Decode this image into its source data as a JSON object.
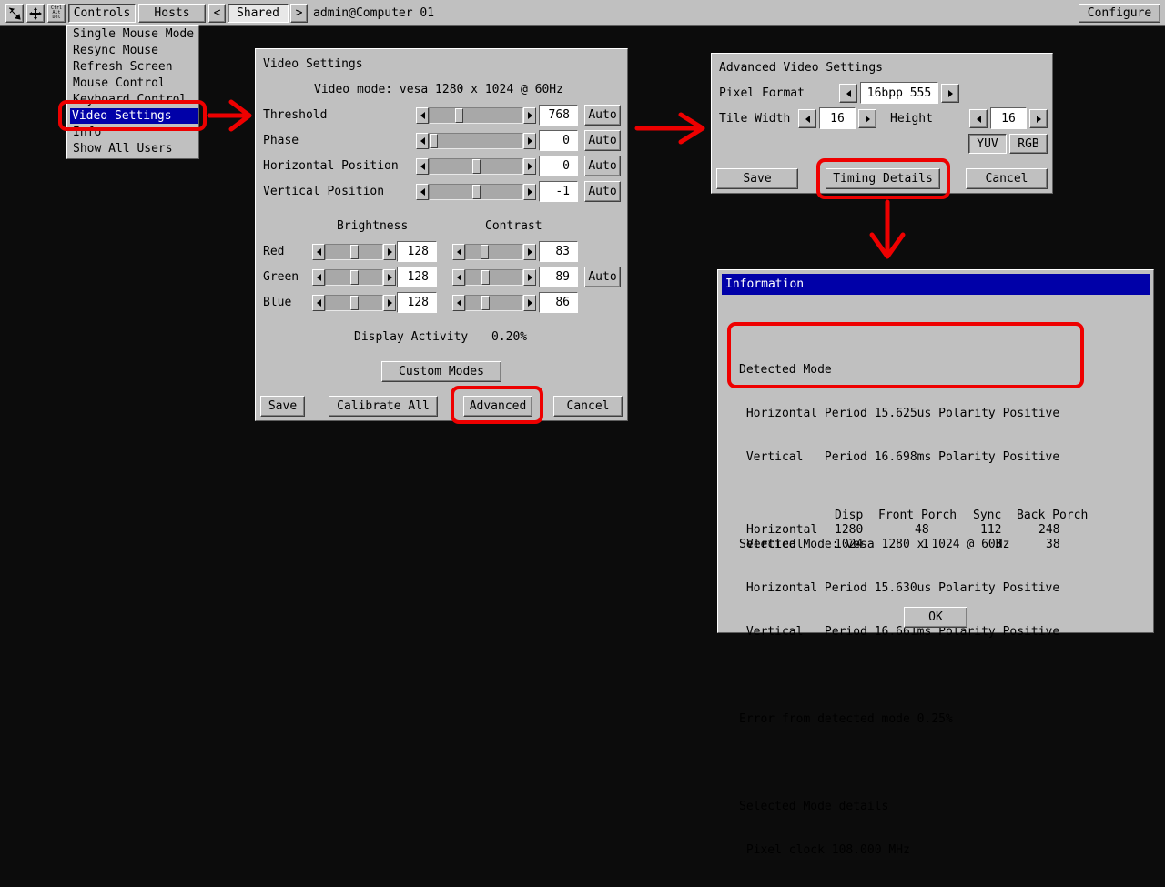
{
  "toolbar": {
    "icons": [
      "pointer-arrows-icon",
      "move-cross-icon",
      "ctrl-alt-del-icon"
    ],
    "ctrl_alt_del_text": [
      "Ctrl",
      "Alt",
      "Del"
    ],
    "controls_label": "Controls",
    "hosts_label": "Hosts",
    "prev_label": "<",
    "shared_label": "Shared",
    "next_label": ">",
    "target_label": "admin@Computer 01",
    "configure_label": "Configure"
  },
  "controls_menu": {
    "items": [
      "Single Mouse Mode",
      "Resync Mouse",
      "Refresh Screen",
      "Mouse Control",
      "Keyboard Control",
      "Video Settings",
      "Info",
      "Show All Users"
    ],
    "selected": "Video Settings"
  },
  "video_settings": {
    "title": "Video Settings",
    "video_mode": "Video mode: vesa 1280 x 1024 @ 60Hz",
    "rows": [
      {
        "label": "Threshold",
        "value": "768",
        "auto": "Auto",
        "level": 0.3
      },
      {
        "label": "Phase",
        "value": "0",
        "auto": "Auto",
        "level": 0.0
      },
      {
        "label": "Horizontal Position",
        "value": "0",
        "auto": "Auto",
        "level": 0.5
      },
      {
        "label": "Vertical Position",
        "value": "-1",
        "auto": "Auto",
        "level": 0.5
      }
    ],
    "brightness_header": "Brightness",
    "contrast_header": "Contrast",
    "colors": [
      {
        "label": "Red",
        "brightness": "128",
        "contrast": "83",
        "b_level": 0.5,
        "c_level": 0.3,
        "auto": ""
      },
      {
        "label": "Green",
        "brightness": "128",
        "contrast": "89",
        "b_level": 0.5,
        "c_level": 0.33,
        "auto": "Auto"
      },
      {
        "label": "Blue",
        "brightness": "128",
        "contrast": "86",
        "b_level": 0.5,
        "c_level": 0.32,
        "auto": ""
      }
    ],
    "display_activity_label": "Display Activity",
    "display_activity_value": "0.20%",
    "custom_modes_label": "Custom Modes",
    "save_label": "Save",
    "calibrate_label": "Calibrate All",
    "advanced_label": "Advanced",
    "cancel_label": "Cancel"
  },
  "advanced": {
    "title": "Advanced Video Settings",
    "pixel_format_label": "Pixel Format",
    "pixel_format_value": "16bpp 555",
    "tile_width_label": "Tile Width",
    "tile_width_value": "16",
    "height_label": "Height",
    "height_value": "16",
    "yuv_label": "YUV",
    "rgb_label": "RGB",
    "save_label": "Save",
    "timing_label": "Timing Details",
    "cancel_label": "Cancel"
  },
  "information": {
    "title": "Information",
    "detected_title": "Detected Mode",
    "detected_h": " Horizontal Period 15.625us Polarity Positive",
    "detected_v": " Vertical   Period 16.698ms Polarity Positive",
    "selected_title": "Selected Mode: vesa 1280 x 1024 @ 60Hz",
    "selected_h": " Horizontal Period 15.630us Polarity Positive",
    "selected_v": " Vertical   Period 16.661ms Polarity Positive",
    "error_line": "Error from detected mode 0.25%",
    "details_title": "Selected Mode details",
    "pixel_clock": " Pixel clock 108.000 MHz",
    "table_header": [
      "",
      "Disp",
      "Front Porch",
      "Sync",
      "Back Porch"
    ],
    "table_rows": [
      [
        "Horizontal",
        "1280",
        "48",
        "112",
        "248"
      ],
      [
        "Vertical",
        "1024",
        "1",
        "3",
        "38"
      ]
    ],
    "ok_label": "OK"
  },
  "colors": {
    "background": "#0c0c0c",
    "panel": "#c0c0c0",
    "highlight": "#ee0000",
    "title_bar": "#0000a8",
    "menu_selection": "#0000a8"
  }
}
